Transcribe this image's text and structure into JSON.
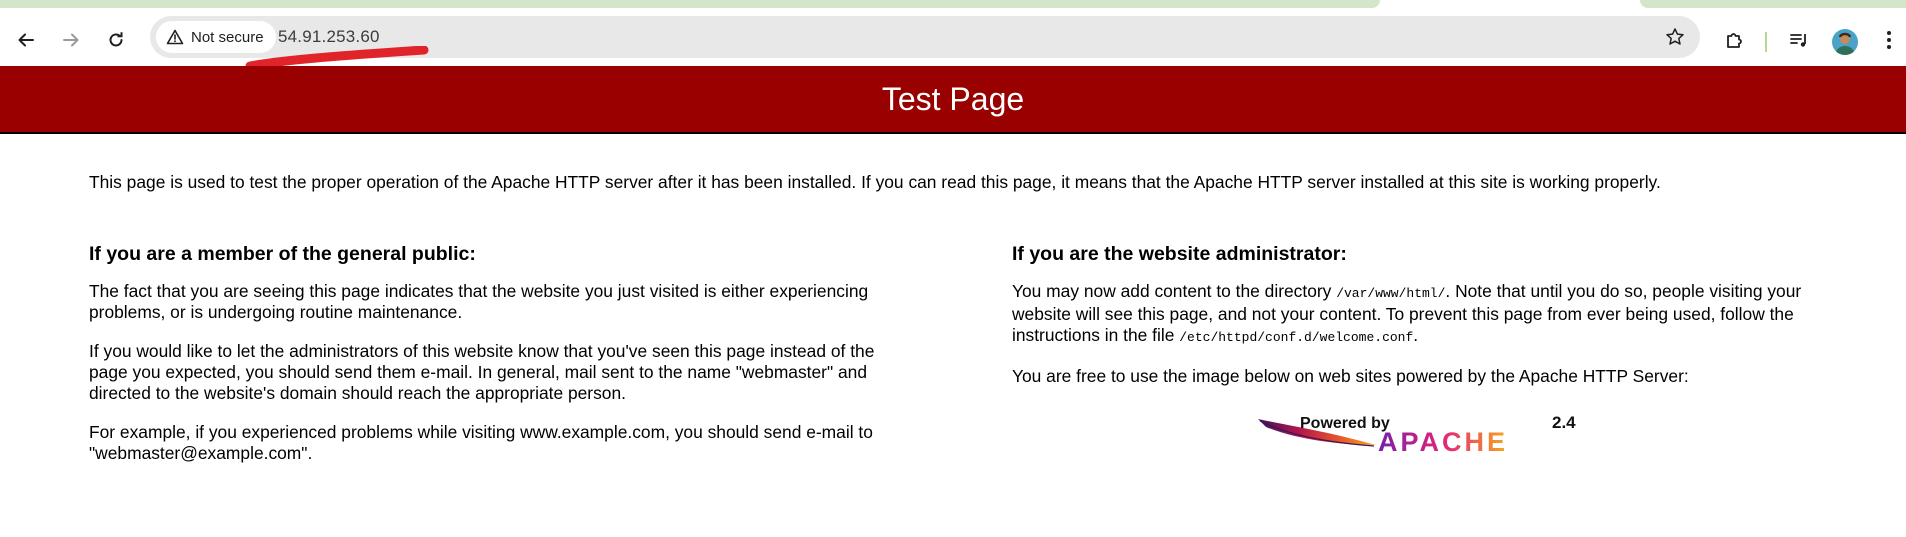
{
  "browser": {
    "back_label": "Back",
    "forward_label": "Forward",
    "reload_label": "Reload",
    "security_label": "Not secure",
    "url": "54.91.253.60"
  },
  "page": {
    "title": "Test Page",
    "intro": "This page is used to test the proper operation of the Apache HTTP server after it has been installed. If you can read this page, it means that the Apache HTTP server installed at this site is working properly.",
    "left": {
      "heading": "If you are a member of the general public:",
      "p1": "The fact that you are seeing this page indicates that the website you just visited is either experiencing problems, or is undergoing routine maintenance.",
      "p2": "If you would like to let the administrators of this website know that you've seen this page instead of the page you expected, you should send them e-mail. In general, mail sent to the name \"webmaster\" and directed to the website's domain should reach the appropriate person.",
      "p3": "For example, if you experienced problems while visiting www.example.com, you should send e-mail to \"webmaster@example.com\"."
    },
    "right": {
      "heading": "If you are the website administrator:",
      "p1_a": "You may now add content to the directory ",
      "p1_code1": "/var/www/html/",
      "p1_b": ". Note that until you do so, people visiting your website will see this page, and not your content. To prevent this page from ever being used, follow the instructions in the file ",
      "p1_code2": "/etc/httpd/conf.d/welcome.conf",
      "p1_c": ".",
      "p2": "You are free to use the image below on web sites powered by the Apache HTTP Server:"
    },
    "powered_by": {
      "line1": "Powered by",
      "brand": "APACHE",
      "version": "2.4"
    }
  },
  "colors": {
    "banner": "#990000",
    "tab_accent": "#d3e6c9",
    "scribble": "#e0242a"
  }
}
